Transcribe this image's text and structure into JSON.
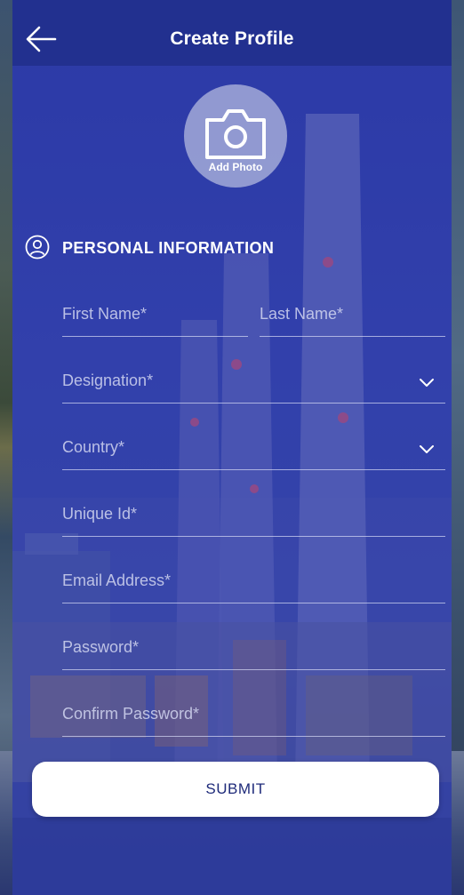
{
  "header": {
    "title": "Create Profile"
  },
  "avatar": {
    "label": "Add Photo"
  },
  "section": {
    "title": "PERSONAL INFORMATION"
  },
  "form": {
    "first_name": "First Name*",
    "last_name": "Last Name*",
    "designation": "Designation*",
    "country": "Country*",
    "unique_id": "Unique Id*",
    "email": "Email Address*",
    "password": "Password*",
    "confirm_password": "Confirm Password*"
  },
  "submit": {
    "label": "SUBMIT"
  },
  "colors": {
    "header": "#22308f",
    "overlay": "#3644ad",
    "button_text": "#1f2b7a"
  }
}
